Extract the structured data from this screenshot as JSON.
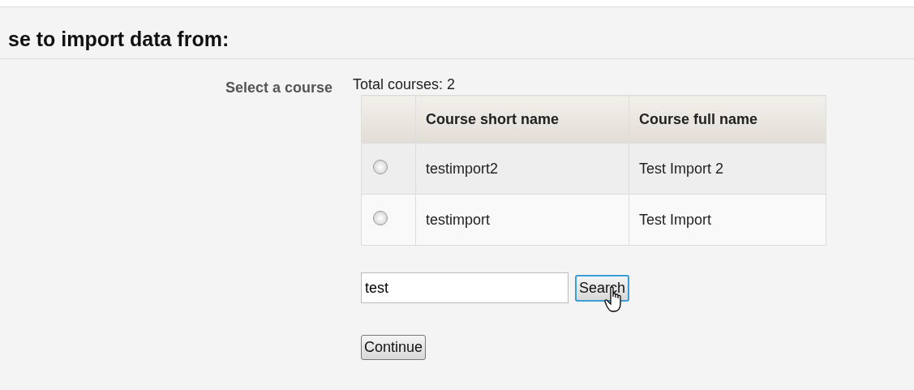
{
  "heading": "se to import data from:",
  "field_label": "Select a course",
  "total": "Total courses: 2",
  "table": {
    "columns": [
      "Course short name",
      "Course full name"
    ],
    "rows": [
      {
        "short_name": "testimport2",
        "full_name": "Test Import 2",
        "selected": false
      },
      {
        "short_name": "testimport",
        "full_name": "Test Import",
        "selected": false
      }
    ]
  },
  "search": {
    "value": "test",
    "button": "Search"
  },
  "continue_button": "Continue"
}
